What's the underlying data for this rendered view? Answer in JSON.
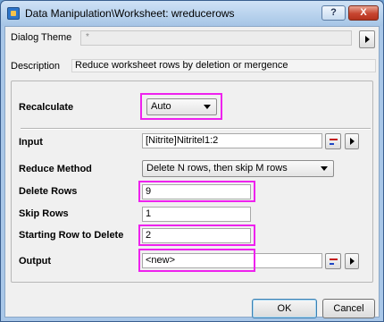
{
  "window": {
    "title": "Data Manipulation\\Worksheet: wreducerows",
    "help_label": "?",
    "close_label": "X"
  },
  "theme": {
    "label": "Dialog Theme",
    "value": "*"
  },
  "description": {
    "label": "Description",
    "value": "Reduce worksheet rows by deletion or mergence"
  },
  "form": {
    "recalculate": {
      "label": "Recalculate",
      "value": "Auto"
    },
    "input": {
      "label": "Input",
      "value": "[Nitrite]Nitritel1:2"
    },
    "reduce_method": {
      "label": "Reduce Method",
      "value": "Delete N rows, then skip M rows"
    },
    "delete_rows": {
      "label": "Delete Rows",
      "value": "9"
    },
    "skip_rows": {
      "label": "Skip Rows",
      "value": "1"
    },
    "starting_row": {
      "label": "Starting Row to Delete",
      "value": "2"
    },
    "output": {
      "label": "Output",
      "value": "<new>"
    }
  },
  "buttons": {
    "ok": "OK",
    "cancel": "Cancel"
  },
  "colors": {
    "highlight": "#ee22ee",
    "title_gradient_top": "#cfe2f6",
    "close_red": "#c74630"
  }
}
